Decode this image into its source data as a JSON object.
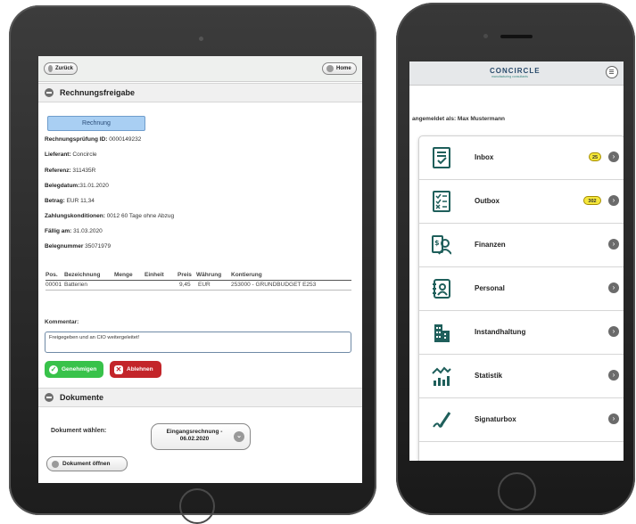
{
  "tablet": {
    "back_label": "Zurück",
    "home_label": "Home",
    "section_invoice": "Rechnungsfreigabe",
    "tab_label": "Rechnung",
    "fields": [
      {
        "label": "Rechnungsprüfung ID:",
        "value": " 0000149232"
      },
      {
        "label": "Lieferant:",
        "value": " Concircle"
      },
      {
        "label": "Referenz:",
        "value": " 311435R"
      },
      {
        "label": "Belegdatum:",
        "value": "31.01.2020"
      },
      {
        "label": "Betrag:",
        "value": " EUR 11,34"
      },
      {
        "label": "Zahlungskonditionen:",
        "value": " 0012 60 Tage ohne Abzug"
      },
      {
        "label": "Fällig am:",
        "value": " 31.03.2020"
      },
      {
        "label": "Belegnummer",
        "value": " 35071979"
      }
    ],
    "table": {
      "headers": [
        "Pos.",
        "Bezeichnung",
        "Menge",
        "Einheit",
        "Preis",
        "Währung",
        "Kontierung"
      ],
      "rows": [
        [
          "00001",
          "Batterien",
          "",
          "",
          "9,45",
          "EUR",
          "253000 - GRUNDBUDGET E253"
        ]
      ]
    },
    "comment_label": "Kommentar:",
    "comment_value": "Freigegeben und an CIO weitergeleitet!",
    "approve_label": "Genehmigen",
    "reject_label": "Ablehnen",
    "section_documents": "Dokumente",
    "doc_select_label": "Dokument wählen:",
    "doc_select_value_line1": "Eingangsrechnung -",
    "doc_select_value_line2": "06.02.2020",
    "open_doc_label": "Dokument öffnen"
  },
  "phone": {
    "logo": "CONCIRCLE",
    "logo_sub": "manufacturing consultants",
    "logged_in": "angemeldet als: Max Mustermann",
    "menu": [
      {
        "label": "Inbox",
        "badge": "25",
        "icon": "inbox-icon"
      },
      {
        "label": "Outbox",
        "badge": "302",
        "icon": "outbox-checklist-icon"
      },
      {
        "label": "Finanzen",
        "badge": "",
        "icon": "finance-icon"
      },
      {
        "label": "Personal",
        "badge": "",
        "icon": "personnel-icon"
      },
      {
        "label": "Instandhaltung",
        "badge": "",
        "icon": "building-icon"
      },
      {
        "label": "Statistik",
        "badge": "",
        "icon": "statistics-icon"
      },
      {
        "label": "Signaturbox",
        "badge": "",
        "icon": "signature-icon"
      }
    ]
  },
  "colors": {
    "accent_blue": "#a9cff3",
    "approve_green": "#38c24a",
    "reject_red": "#c3252a",
    "icon_teal": "#1f5f5b",
    "badge_yellow": "#f5e73b"
  }
}
